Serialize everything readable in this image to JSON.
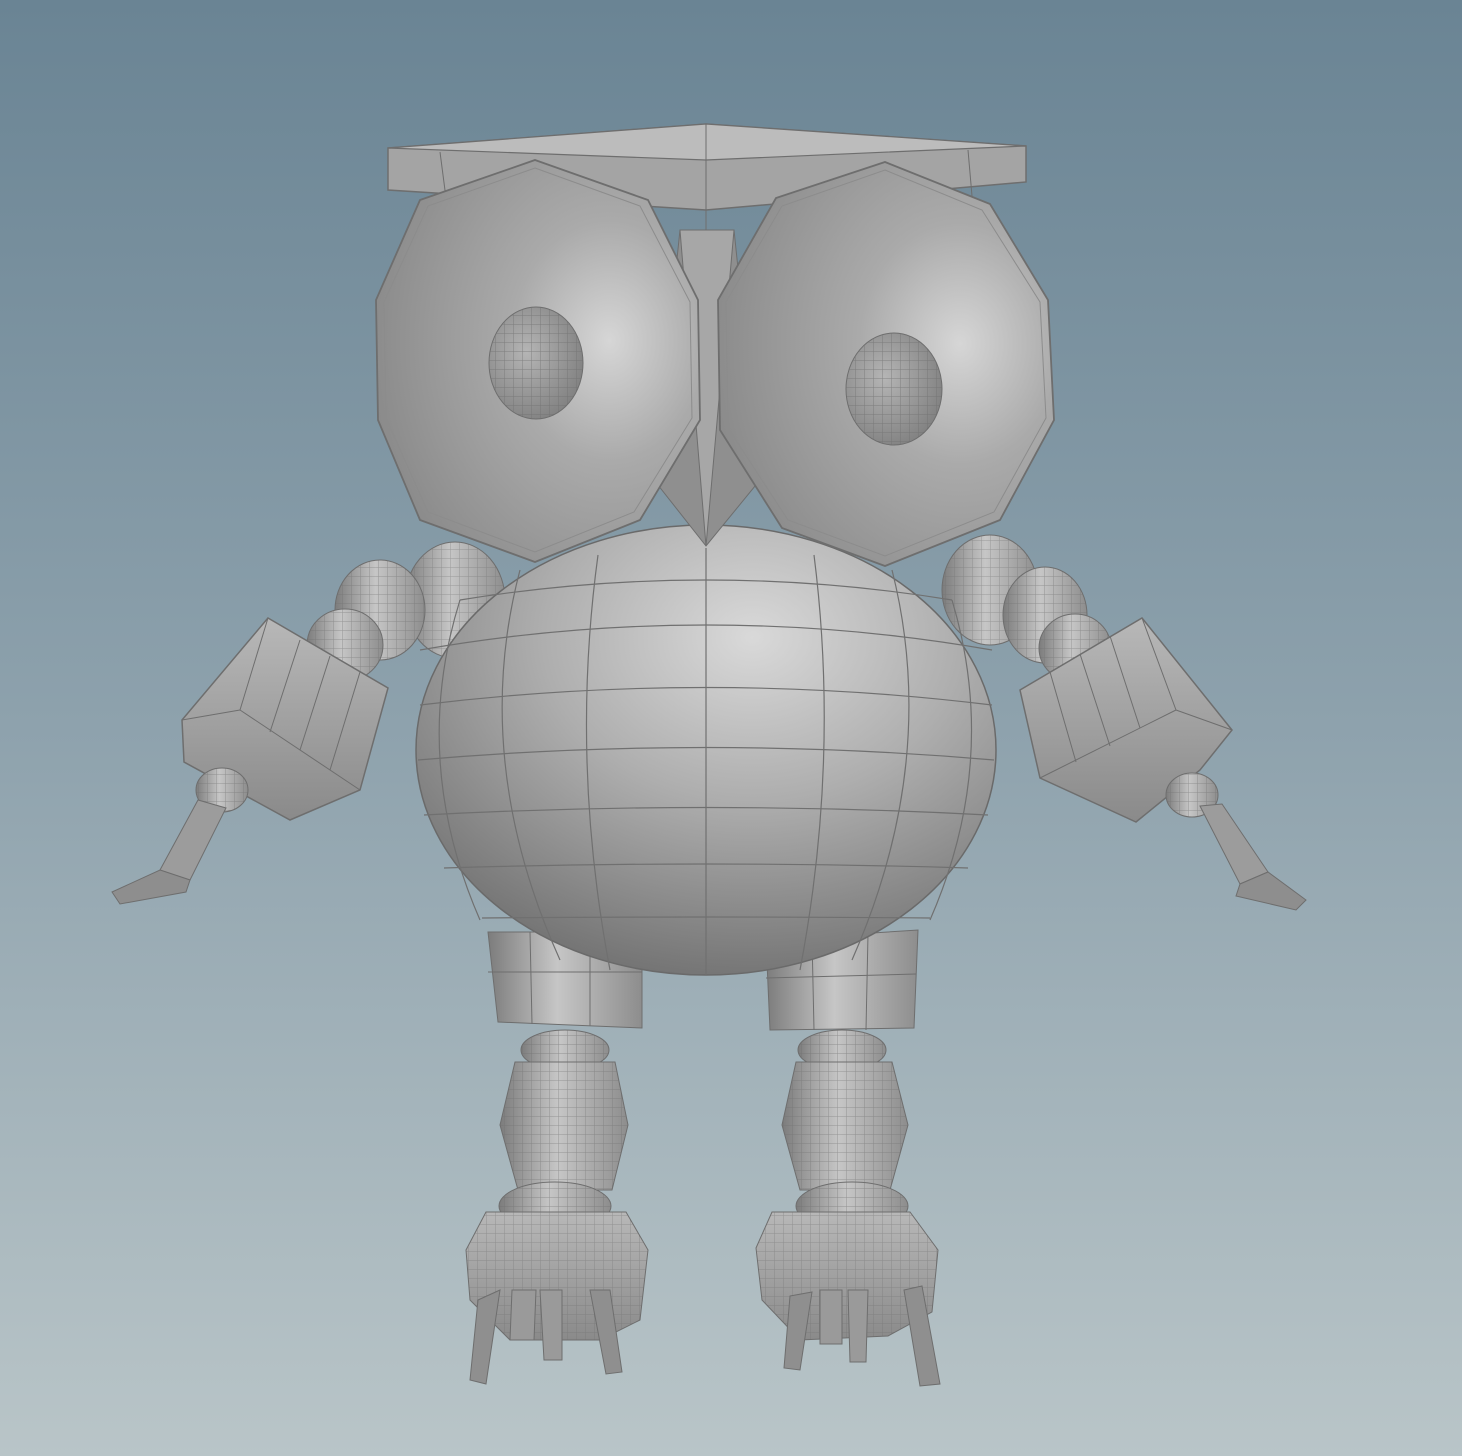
{
  "viewport": {
    "name": "3d-viewport",
    "background_top": "#6a8494",
    "background_bottom": "#b9c5c8"
  },
  "model": {
    "subject": "owl-model",
    "display_mode": "shaded-wireframe",
    "mesh_color": "#a9a9a9",
    "wire_color": "#6e6e6e"
  }
}
